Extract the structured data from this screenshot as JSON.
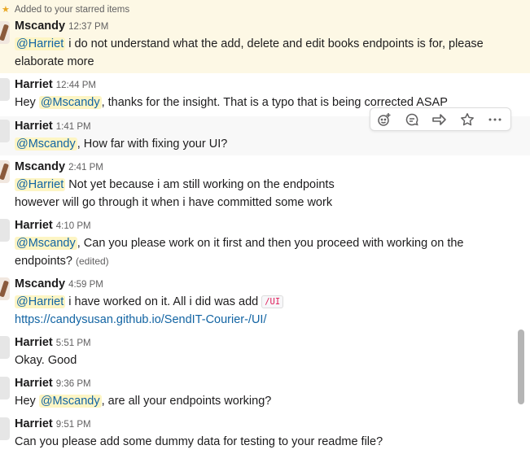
{
  "starred_notice": "Added to your starred items",
  "messages": [
    {
      "author": "Mscandy",
      "time": "12:37 PM",
      "lines": [
        [
          {
            "t": "@Harriet",
            "k": "mention"
          },
          {
            "t": " i do not understand what the add, delete and edit books endpoints is for, please",
            "k": "text"
          }
        ],
        [
          {
            "t": "elaborate more",
            "k": "text"
          }
        ]
      ]
    },
    {
      "author": "Harriet",
      "time": "12:44 PM",
      "lines": [
        [
          {
            "t": "Hey ",
            "k": "text"
          },
          {
            "t": "@Mscandy",
            "k": "mention"
          },
          {
            "t": ", thanks for the insight. That is a typo that is being corrected ASAP",
            "k": "text"
          }
        ]
      ]
    },
    {
      "author": "Harriet",
      "time": "1:41 PM",
      "lines": [
        [
          {
            "t": "@Mscandy",
            "k": "mention"
          },
          {
            "t": ", How far with fixing your UI?",
            "k": "text"
          }
        ]
      ]
    },
    {
      "author": "Mscandy",
      "time": "2:41 PM",
      "lines": [
        [
          {
            "t": "@Harriet",
            "k": "mention"
          },
          {
            "t": " Not yet because i am still working on the endpoints",
            "k": "text"
          }
        ],
        [
          {
            "t": "however will go through it when i have committed some work",
            "k": "text"
          }
        ]
      ]
    },
    {
      "author": "Harriet",
      "time": "4:10 PM",
      "lines": [
        [
          {
            "t": "@Mscandy",
            "k": "mention"
          },
          {
            "t": ", Can you please work on it first and then you proceed with  working on the",
            "k": "text"
          }
        ],
        [
          {
            "t": "endpoints? ",
            "k": "text"
          },
          {
            "t": "(edited)",
            "k": "edited"
          }
        ]
      ]
    },
    {
      "author": "Mscandy",
      "time": "4:59 PM",
      "lines": [
        [
          {
            "t": "@Harriet",
            "k": "mention"
          },
          {
            "t": " i have worked on it. All i did was add ",
            "k": "text"
          },
          {
            "t": "/UI",
            "k": "code"
          }
        ],
        [
          {
            "t": "https://candysusan.github.io/SendIT-Courier-/UI/",
            "k": "link"
          }
        ]
      ]
    },
    {
      "author": "Harriet",
      "time": "5:51 PM",
      "lines": [
        [
          {
            "t": "Okay. Good",
            "k": "text"
          }
        ]
      ]
    },
    {
      "author": "Harriet",
      "time": "9:36 PM",
      "lines": [
        [
          {
            "t": "Hey ",
            "k": "text"
          },
          {
            "t": "@Mscandy",
            "k": "mention"
          },
          {
            "t": ", are all your endpoints working?",
            "k": "text"
          }
        ]
      ]
    },
    {
      "author": "Harriet",
      "time": "9:51 PM",
      "lines": [
        [
          {
            "t": "Can you please add some dummy data for testing to your readme file?",
            "k": "text"
          }
        ]
      ]
    }
  ],
  "message_actions": [
    {
      "icon": "emoji-reaction-icon"
    },
    {
      "icon": "start-thread-icon"
    },
    {
      "icon": "share-message-icon"
    },
    {
      "icon": "star-icon"
    },
    {
      "icon": "more-actions-icon"
    }
  ]
}
